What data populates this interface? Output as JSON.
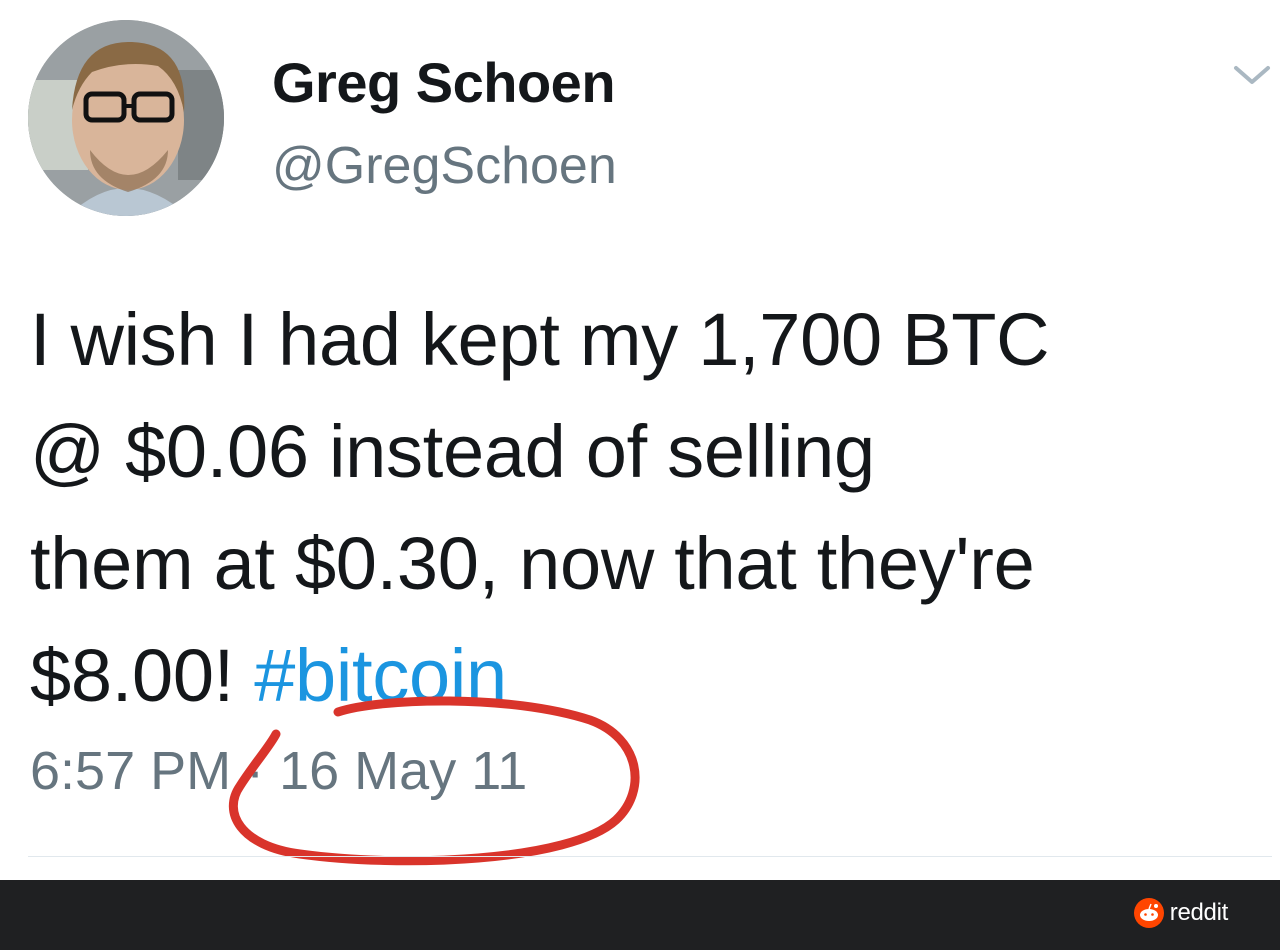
{
  "tweet": {
    "author": {
      "display_name": "Greg Schoen",
      "handle": "@GregSchoen"
    },
    "text_parts": [
      "I wish I had kept my 1,700 BTC",
      "@ $0.06 instead of selling",
      "them at $0.30, now that they're",
      "$8.00! "
    ],
    "hashtag": "#bitcoin",
    "time": "6:57 PM",
    "separator": " · ",
    "date": "16 May 11"
  },
  "footer": {
    "brand": "reddit"
  },
  "colors": {
    "hashtag": "#1b95e0",
    "annotation_circle": "#d9342b",
    "footer_background": "#1f2022",
    "reddit_orange": "#ff4500"
  },
  "icons": {
    "menu": "chevron-down-icon",
    "brand": "reddit-logo-icon"
  }
}
